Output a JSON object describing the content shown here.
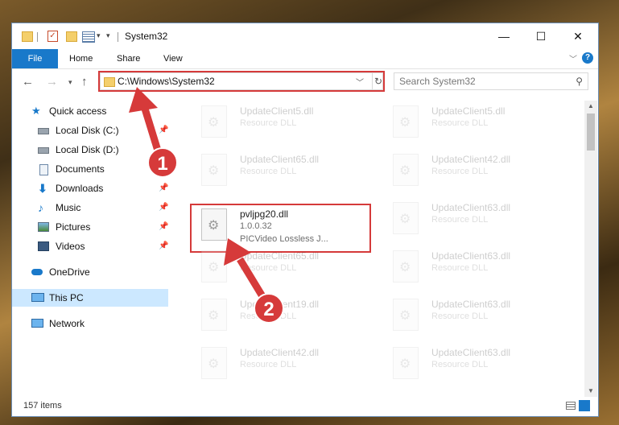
{
  "window": {
    "title": "System32",
    "controls": {
      "minimize": "—",
      "maximize": "☐",
      "close": "✕"
    }
  },
  "ribbon": {
    "tabs": [
      "File",
      "Home",
      "Share",
      "View"
    ],
    "help": "?"
  },
  "address": {
    "path": "C:\\Windows\\System32",
    "search_placeholder": "Search System32"
  },
  "sidebar": {
    "items": [
      {
        "label": "Quick access",
        "icon": "star-icon",
        "pinned": false
      },
      {
        "label": "Local Disk (C:)",
        "icon": "drive-icon",
        "pinned": true
      },
      {
        "label": "Local Disk (D:)",
        "icon": "drive-icon",
        "pinned": false
      },
      {
        "label": "Documents",
        "icon": "documents-icon",
        "pinned": true
      },
      {
        "label": "Downloads",
        "icon": "download-icon",
        "pinned": true
      },
      {
        "label": "Music",
        "icon": "music-icon",
        "pinned": true
      },
      {
        "label": "Pictures",
        "icon": "pictures-icon",
        "pinned": true
      },
      {
        "label": "Videos",
        "icon": "videos-icon",
        "pinned": true
      },
      {
        "label": "OneDrive",
        "icon": "cloud-icon",
        "pinned": false
      },
      {
        "label": "This PC",
        "icon": "computer-icon",
        "pinned": false,
        "selected": true
      },
      {
        "label": "Network",
        "icon": "network-icon",
        "pinned": false
      }
    ]
  },
  "files": {
    "left": [
      {
        "name": "UpdateClient5.dll",
        "desc": "Resource DLL"
      },
      {
        "name": "UpdateClient65.dll",
        "desc": "Resource DLL"
      },
      {
        "name": "pvljpg20.dll",
        "version": "1.0.0.32",
        "desc": "PICVideo Lossless J...",
        "highlighted": true
      },
      {
        "name": "UpdateClient65.dll",
        "desc": "Resource DLL"
      },
      {
        "name": "UpdateClient19.dll",
        "desc": "Resource DLL"
      },
      {
        "name": "UpdateClient42.dll",
        "desc": "Resource DLL"
      }
    ],
    "right": [
      {
        "name": "UpdateClient5.dll",
        "desc": "Resource DLL"
      },
      {
        "name": "UpdateClient42.dll",
        "desc": "Resource DLL"
      },
      {
        "name": "UpdateClient63.dll",
        "desc": "Resource DLL"
      },
      {
        "name": "UpdateClient63.dll",
        "desc": "Resource DLL"
      },
      {
        "name": "UpdateClient63.dll",
        "desc": "Resource DLL"
      },
      {
        "name": "UpdateClient63.dll",
        "desc": "Resource DLL"
      }
    ]
  },
  "status": {
    "count": "157 items"
  },
  "callouts": {
    "one": "1",
    "two": "2"
  },
  "colors": {
    "accent": "#1979ca",
    "highlight": "#d53a3a",
    "selected": "#cce8ff"
  }
}
